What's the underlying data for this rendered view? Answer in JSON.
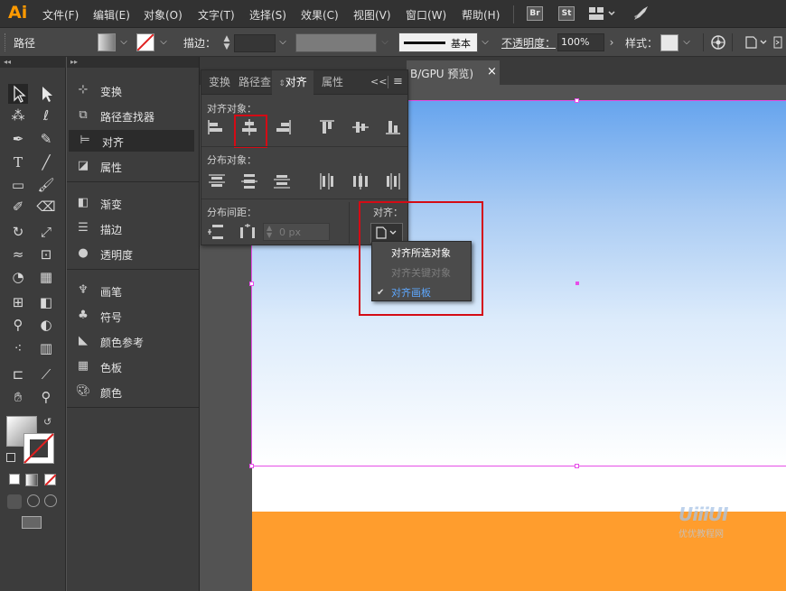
{
  "menubar": {
    "logo": "Ai",
    "items": [
      "文件(F)",
      "编辑(E)",
      "对象(O)",
      "文字(T)",
      "选择(S)",
      "效果(C)",
      "视图(V)",
      "窗口(W)",
      "帮助(H)"
    ],
    "bridge_badge": "Br",
    "stock_badge": "St"
  },
  "control_bar": {
    "selection_label": "路径",
    "stroke_label": "描边：",
    "brush_label": "基本",
    "opacity_label": "不透明度：",
    "opacity_value": "100%",
    "style_label": "样式："
  },
  "panels": {
    "group1": [
      "变换",
      "路径查找器",
      "对齐",
      "属性"
    ],
    "group2": [
      "渐变",
      "描边",
      "透明度"
    ],
    "group3": [
      "画笔",
      "符号",
      "颜色参考",
      "色板",
      "颜色"
    ],
    "active_item": "对齐"
  },
  "document_tab": {
    "title_fragment": "B/GPU 预览)",
    "close": "×"
  },
  "align_panel": {
    "tabs": [
      "变换",
      "路径查",
      "对齐",
      "属性"
    ],
    "active_tab": "对齐",
    "collapse_glyph": "<<",
    "menu_glyph": "≡",
    "align_objects_label": "对齐对象：",
    "distribute_objects_label": "分布对象：",
    "distribute_spacing_label": "分布间距：",
    "align_to_label": "对齐：",
    "spacing_value": "0 px"
  },
  "align_to_dropdown": {
    "items": [
      {
        "label": "对齐所选对象",
        "state": "normal"
      },
      {
        "label": "对齐关键对象",
        "state": "disabled"
      },
      {
        "label": "对齐画板",
        "state": "checked"
      }
    ],
    "check_glyph": "✔"
  },
  "watermark": {
    "logo": "UiiiUI",
    "text": "优优教程网"
  },
  "colors": {
    "accent_orange": "#ff9a00",
    "highlight_red": "#d40b15",
    "artboard_border": "#e64ee8",
    "artboard_orange": "#ff9d2d",
    "checked_blue": "#5ea8ff"
  }
}
